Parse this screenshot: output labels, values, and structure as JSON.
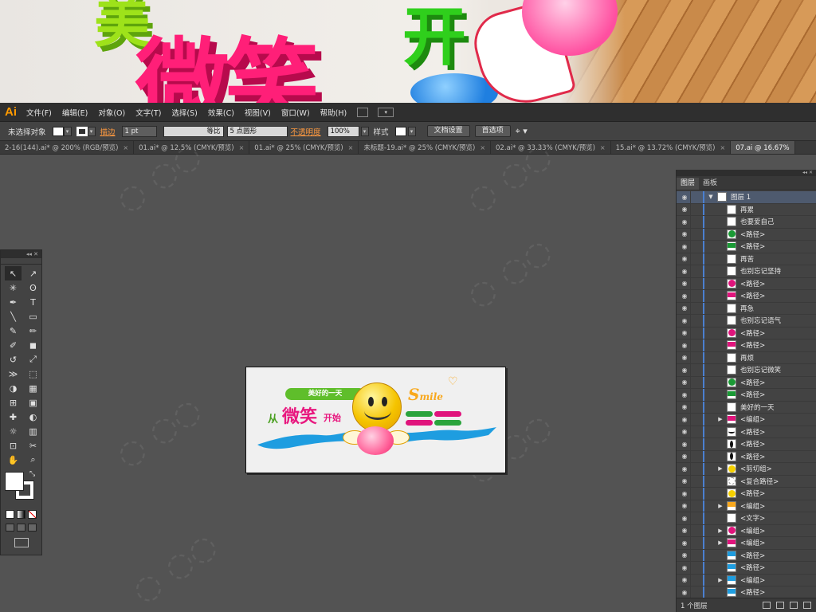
{
  "hero": {
    "chars": [
      "美",
      "微笑",
      "开"
    ]
  },
  "menubar": {
    "logo": "Ai",
    "items": [
      "文件(F)",
      "编辑(E)",
      "对象(O)",
      "文字(T)",
      "选择(S)",
      "效果(C)",
      "视图(V)",
      "窗口(W)",
      "帮助(H)"
    ]
  },
  "control": {
    "no_selection": "未选择对象",
    "stroke_label": "描边",
    "stroke_value": "1 pt",
    "stroke_style": "等比",
    "brush": "5 点圆形",
    "opacity_label": "不透明度",
    "opacity_value": "100%",
    "style_label": "样式",
    "doc_setup": "文档设置",
    "prefs": "首选项"
  },
  "tabs": [
    "2-16(144).ai* @ 200% (RGB/预览)",
    "01.ai* @ 12.5% (CMYK/预览)",
    "01.ai* @ 25% (CMYK/预览)",
    "未标题-19.ai* @ 25% (CMYK/预览)",
    "02.ai* @ 33.33% (CMYK/预览)",
    "15.ai* @ 13.72% (CMYK/预览)",
    "07.ai @ 16.67%"
  ],
  "artboard": {
    "pill": "美好的一天",
    "from": "从",
    "smile_cn": "微笑",
    "start": "开始",
    "smile_en_big": "S",
    "smile_en_small": "mile"
  },
  "layers": {
    "tab_layers": "图层",
    "tab_artboards": "画板",
    "parent": "图层 1",
    "items": [
      {
        "name": "再累",
        "thumb": "white",
        "expand": false
      },
      {
        "name": "也要爱自己",
        "thumb": "white",
        "expand": false
      },
      {
        "name": "<路径>",
        "thumb": "#1a9a35",
        "expand": false
      },
      {
        "name": "<路径>",
        "thumb": "stripe-green",
        "expand": false
      },
      {
        "name": "再苦",
        "thumb": "white",
        "expand": false
      },
      {
        "name": "也别忘记坚持",
        "thumb": "white",
        "expand": false
      },
      {
        "name": "<路径>",
        "thumb": "#e0147c",
        "expand": false
      },
      {
        "name": "<路径>",
        "thumb": "stripe-pink",
        "expand": false
      },
      {
        "name": "再急",
        "thumb": "white",
        "expand": false
      },
      {
        "name": "也别忘记语气",
        "thumb": "white",
        "expand": false
      },
      {
        "name": "<路径>",
        "thumb": "#e0147c",
        "expand": false
      },
      {
        "name": "<路径>",
        "thumb": "stripe-pink",
        "expand": false
      },
      {
        "name": "再烦",
        "thumb": "white",
        "expand": false
      },
      {
        "name": "也别忘记微笑",
        "thumb": "white",
        "expand": false
      },
      {
        "name": "<路径>",
        "thumb": "#1a9a35",
        "expand": false
      },
      {
        "name": "<路径>",
        "thumb": "stripe-green",
        "expand": false
      },
      {
        "name": "美好的一天",
        "thumb": "white",
        "expand": false
      },
      {
        "name": "<编组>",
        "thumb": "stripe-pink",
        "expand": true
      },
      {
        "name": "<路径>",
        "thumb": "curve-black",
        "expand": false
      },
      {
        "name": "<路径>",
        "thumb": "oval-black",
        "expand": false
      },
      {
        "name": "<路径>",
        "thumb": "oval-black",
        "expand": false
      },
      {
        "name": "<剪切组>",
        "thumb": "#f5d000",
        "expand": true
      },
      {
        "name": "<复合路径>",
        "thumb": "ring",
        "expand": false
      },
      {
        "name": "<路径>",
        "thumb": "#f5d000",
        "expand": false
      },
      {
        "name": "<编组>",
        "thumb": "stripe-orange",
        "expand": true
      },
      {
        "name": "<文字>",
        "thumb": "white",
        "expand": false
      },
      {
        "name": "<编组>",
        "thumb": "#e0147c",
        "expand": true
      },
      {
        "name": "<编组>",
        "thumb": "stripe-pink",
        "expand": true
      },
      {
        "name": "<路径>",
        "thumb": "stripe-blue",
        "expand": false
      },
      {
        "name": "<路径>",
        "thumb": "stripe-blue",
        "expand": false
      },
      {
        "name": "<编组>",
        "thumb": "stripe-blue",
        "expand": true
      },
      {
        "name": "<路径>",
        "thumb": "stripe-blue",
        "expand": false
      }
    ],
    "footer_count": "1 个图层"
  },
  "tools": {
    "icons": [
      "selection-icon",
      "direct-selection-icon",
      "magic-wand-icon",
      "lasso-icon",
      "pen-icon",
      "type-icon",
      "line-icon",
      "rectangle-icon",
      "paintbrush-icon",
      "pencil-icon",
      "blob-brush-icon",
      "eraser-icon",
      "rotate-icon",
      "scale-icon",
      "width-icon",
      "free-transform-icon",
      "shape-builder-icon",
      "perspective-icon",
      "mesh-icon",
      "gradient-icon",
      "eyedropper-icon",
      "blend-icon",
      "symbol-sprayer-icon",
      "graph-icon",
      "artboard-icon",
      "slice-icon",
      "hand-icon",
      "zoom-icon"
    ],
    "glyphs": [
      "↖",
      "↗",
      "✳",
      "ʘ",
      "✒",
      "T",
      "╲",
      "▭",
      "✎",
      "✏",
      "✐",
      "◼",
      "↺",
      "⤢",
      "≫",
      "⬚",
      "◑",
      "▦",
      "⊞",
      "▣",
      "✚",
      "◐",
      "☼",
      "▥",
      "⊡",
      "✂",
      "✋",
      "⌕"
    ]
  }
}
